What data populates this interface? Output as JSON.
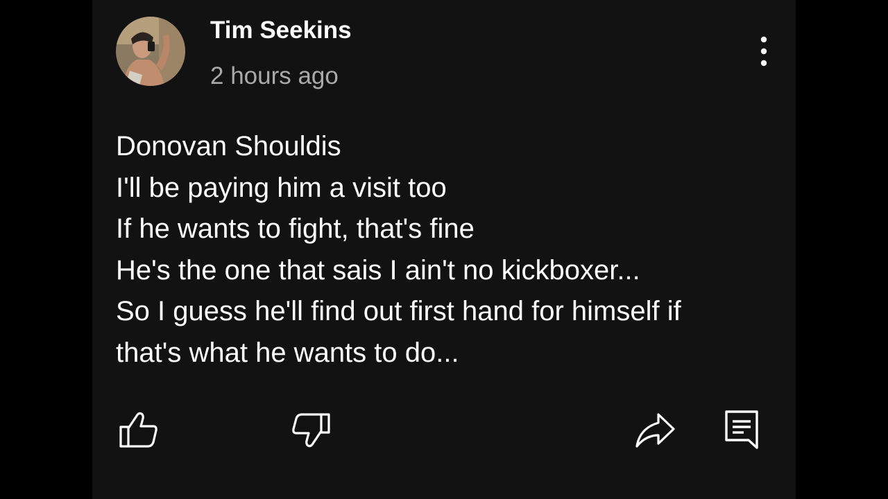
{
  "comment": {
    "author": "Tim Seekins",
    "timestamp": "2 hours ago",
    "lines": [
      "Donovan Shouldis",
      "I'll be paying him a visit too",
      "If he wants to fight, that's fine",
      "He's the one that sais I ain't no kickboxer...",
      "So I guess he'll find out first hand for himself if",
      "that's what he wants to do..."
    ]
  },
  "icons": {
    "more": "more-vertical-icon",
    "like": "thumbs-up-icon",
    "dislike": "thumbs-down-icon",
    "share": "share-icon",
    "reply": "reply-comment-icon"
  },
  "colors": {
    "background": "#121212",
    "outer": "#000000",
    "text": "#ffffff",
    "secondary_text": "#aaaaaa"
  }
}
